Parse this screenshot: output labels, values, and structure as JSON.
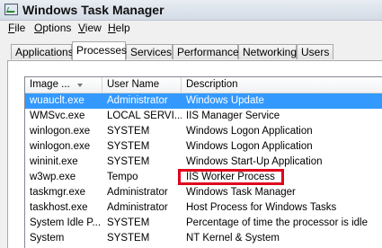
{
  "window": {
    "title": "Windows Task Manager"
  },
  "menu": [
    {
      "label": "File",
      "mnemonic": "F",
      "rest": "ile"
    },
    {
      "label": "Options",
      "mnemonic": "O",
      "rest": "ptions"
    },
    {
      "label": "View",
      "mnemonic": "V",
      "rest": "iew"
    },
    {
      "label": "Help",
      "mnemonic": "H",
      "rest": "elp"
    }
  ],
  "tabs": [
    {
      "label": "Applications"
    },
    {
      "label": "Processes",
      "active": true
    },
    {
      "label": "Services"
    },
    {
      "label": "Performance"
    },
    {
      "label": "Networking"
    },
    {
      "label": "Users"
    }
  ],
  "columns": {
    "image": "Image ...",
    "user": "User Name",
    "description": "Description"
  },
  "rows": [
    {
      "image": "wuauclt.exe",
      "user": "Administrator",
      "description": "Windows Update",
      "selected": true
    },
    {
      "image": "WMSvc.exe",
      "user": "LOCAL SERVI...",
      "description": "IIS Manager Service"
    },
    {
      "image": "winlogon.exe",
      "user": "SYSTEM",
      "description": "Windows Logon Application"
    },
    {
      "image": "winlogon.exe",
      "user": "SYSTEM",
      "description": "Windows Logon Application"
    },
    {
      "image": "wininit.exe",
      "user": "SYSTEM",
      "description": "Windows Start-Up Application"
    },
    {
      "image": "w3wp.exe",
      "user": "Tempo",
      "description": "IIS Worker Process",
      "highlighted": true
    },
    {
      "image": "taskmgr.exe",
      "user": "Administrator",
      "description": "Windows Task Manager"
    },
    {
      "image": "taskhost.exe",
      "user": "Administrator",
      "description": "Host Process for Windows Tasks"
    },
    {
      "image": "System Idle P...",
      "user": "SYSTEM",
      "description": "Percentage of time the processor is idle"
    },
    {
      "image": "System",
      "user": "SYSTEM",
      "description": "NT Kernel & System"
    }
  ],
  "colors": {
    "selection": "#3399ff",
    "highlight_box": "#e0001b"
  }
}
